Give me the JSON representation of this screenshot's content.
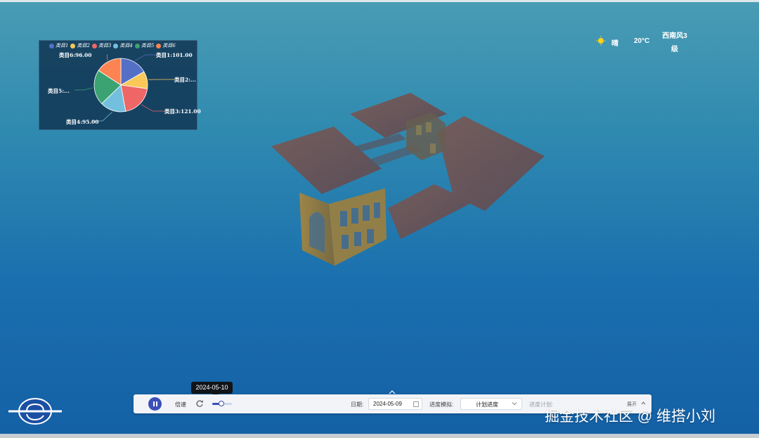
{
  "pie_chart": {
    "legend": [
      "类目1",
      "类目2",
      "类目3",
      "类目4",
      "类目5",
      "类目6"
    ],
    "colors": [
      "#5470c6",
      "#fac858",
      "#ee6666",
      "#73c0de",
      "#3ba272",
      "#fc8452"
    ],
    "labels": [
      "类目1:101.00",
      "类目2:...",
      "类目3:121.00",
      "类目4:95.00",
      "类目5:...",
      "类目6:96.00"
    ]
  },
  "chart_data": {
    "type": "pie",
    "categories": [
      "类目1",
      "类目2",
      "类目3",
      "类目4",
      "类目5",
      "类目6"
    ],
    "values": [
      101,
      64,
      121,
      95,
      130,
      96
    ]
  },
  "weather": {
    "icon": "sun-icon",
    "condition": "晴",
    "temperature": "20°C",
    "wind_line1": "西南风3",
    "wind_line2": "级"
  },
  "control_bar": {
    "speed_label": "倍速",
    "slider_level": 0.45,
    "date_label": "日期:",
    "date_value": "2024-05-09",
    "mode_label": "进度模拟:",
    "mode_value": "计划进度",
    "plan_label": "进度计划:",
    "expand_label": "展开"
  },
  "tooltip": {
    "date": "2024-05-10"
  },
  "watermark": "掘金技术社区 @ 维搭小刘"
}
